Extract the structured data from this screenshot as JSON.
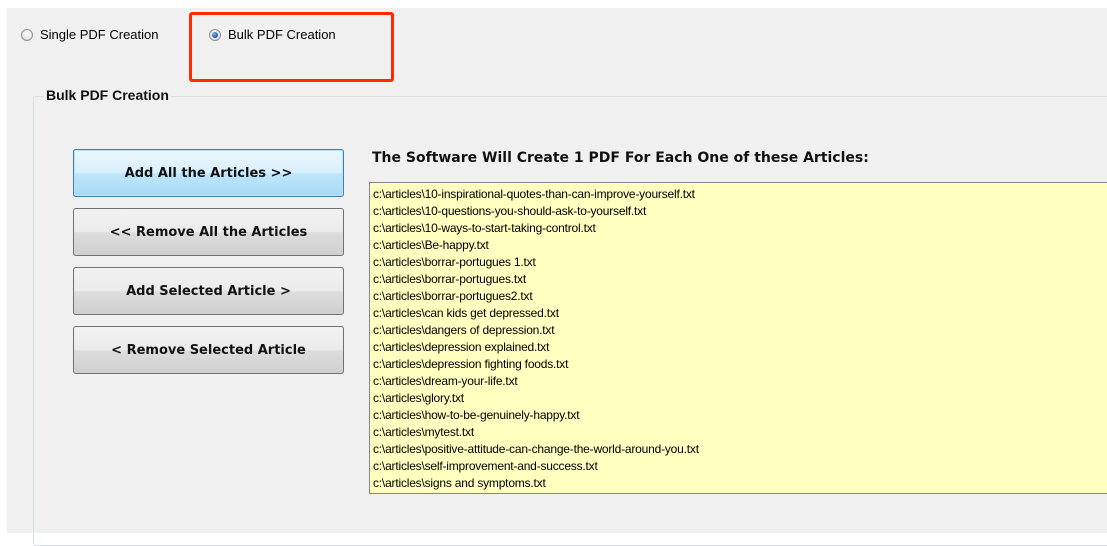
{
  "mode": {
    "single_label": "Single PDF Creation",
    "bulk_label": "Bulk PDF Creation",
    "selected": "bulk"
  },
  "group": {
    "title": "Bulk PDF Creation"
  },
  "buttons": {
    "add_all": "Add All the Articles >>",
    "remove_all": "<< Remove All the Articles",
    "add_selected": "Add Selected Article >",
    "remove_selected": "< Remove Selected Article"
  },
  "list": {
    "title": "The Software Will Create 1 PDF For Each One of these Articles:",
    "background": "#ffffc0",
    "items": [
      "c:\\articles\\10-inspirational-quotes-than-can-improve-yourself.txt",
      "c:\\articles\\10-questions-you-should-ask-to-yourself.txt",
      "c:\\articles\\10-ways-to-start-taking-control.txt",
      "c:\\articles\\Be-happy.txt",
      "c:\\articles\\borrar-portugues 1.txt",
      "c:\\articles\\borrar-portugues.txt",
      "c:\\articles\\borrar-portugues2.txt",
      "c:\\articles\\can kids get depressed.txt",
      "c:\\articles\\dangers of depression.txt",
      "c:\\articles\\depression explained.txt",
      "c:\\articles\\depression fighting foods.txt",
      "c:\\articles\\dream-your-life.txt",
      "c:\\articles\\glory.txt",
      "c:\\articles\\how-to-be-genuinely-happy.txt",
      "c:\\articles\\mytest.txt",
      "c:\\articles\\positive-attitude-can-change-the-world-around-you.txt",
      "c:\\articles\\self-improvement-and-success.txt",
      "c:\\articles\\signs and symptoms.txt"
    ]
  },
  "annotation": {
    "highlight_color": "#ff2a00"
  }
}
